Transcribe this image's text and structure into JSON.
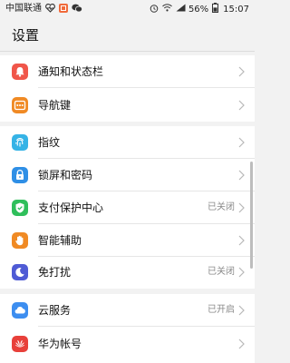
{
  "status_bar": {
    "carrier": "中国联通",
    "battery_percent": "56%",
    "time": "15:07",
    "icons": [
      "heartbeat-icon",
      "app-notification-icon",
      "wechat-icon",
      "alarm-icon",
      "wifi-icon",
      "signal-icon",
      "battery-icon"
    ]
  },
  "header": {
    "title": "设置"
  },
  "sections": [
    {
      "items": [
        {
          "label": "通知和状态栏",
          "icon": "bell-icon",
          "color": "#f0564a",
          "value": ""
        },
        {
          "label": "导航键",
          "icon": "navigation-key-icon",
          "color": "#f08a24",
          "value": ""
        }
      ]
    },
    {
      "items": [
        {
          "label": "指纹",
          "icon": "fingerprint-icon",
          "color": "#35b3e6",
          "value": ""
        },
        {
          "label": "锁屏和密码",
          "icon": "lock-icon",
          "color": "#2f8fe6",
          "value": ""
        },
        {
          "label": "支付保护中心",
          "icon": "shield-check-icon",
          "color": "#2fbf5b",
          "value": "已关闭"
        },
        {
          "label": "智能辅助",
          "icon": "hand-icon",
          "color": "#f08a24",
          "value": ""
        },
        {
          "label": "免打扰",
          "icon": "moon-icon",
          "color": "#4f5bd5",
          "value": "已关闭"
        }
      ]
    },
    {
      "items": [
        {
          "label": "云服务",
          "icon": "cloud-icon",
          "color": "#3d8ef0",
          "value": "已开启"
        },
        {
          "label": "华为帐号",
          "icon": "huawei-icon",
          "color": "#e8403a",
          "value": ""
        }
      ]
    }
  ]
}
